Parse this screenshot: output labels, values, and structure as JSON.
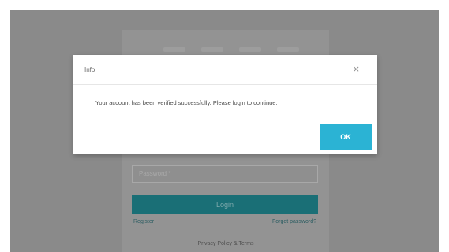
{
  "login": {
    "password_placeholder": "Password *",
    "login_button": "Login",
    "register_link": "Register",
    "forgot_link": "Forgot password?",
    "footer_text": "Privacy Policy & Terms"
  },
  "modal": {
    "title": "Info",
    "close_label": "×",
    "message": "Your account has been verified successfully. Please login to continue.",
    "ok_label": "OK"
  },
  "colors": {
    "accent": "#2bb3d4",
    "login_button": "#1a6f76",
    "backdrop": "#8a8a8a"
  }
}
